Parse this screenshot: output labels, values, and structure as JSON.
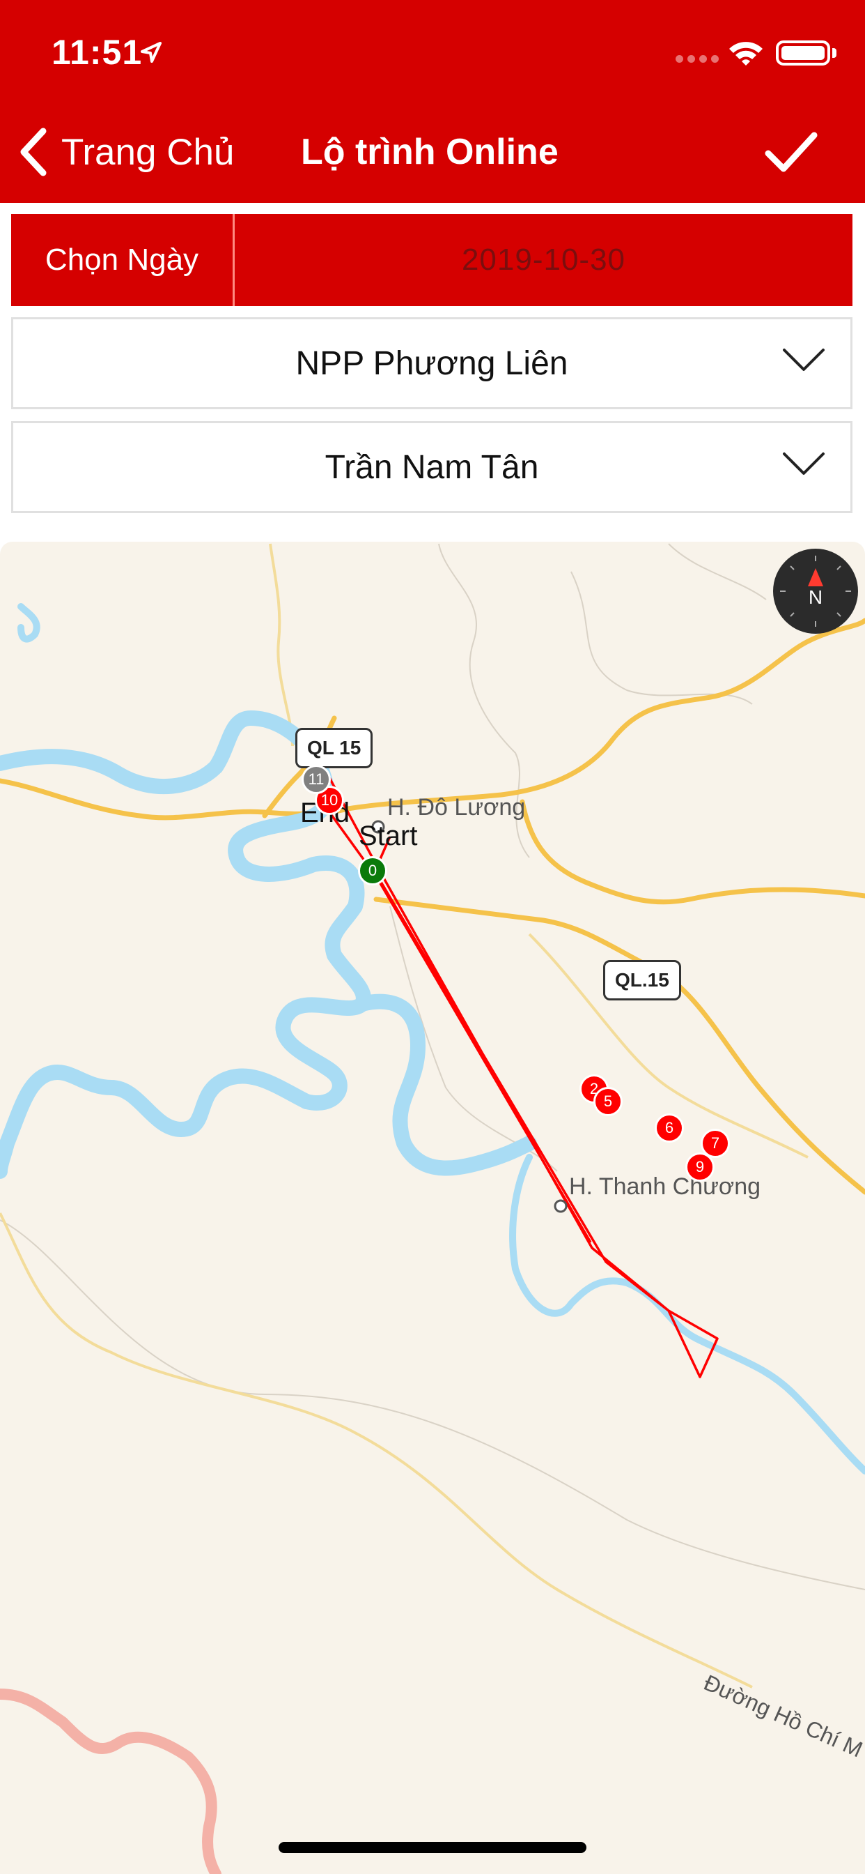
{
  "status_bar": {
    "time": "11:51"
  },
  "nav": {
    "back_label": "Trang Chủ",
    "title": "Lộ trình Online"
  },
  "form": {
    "date_label": "Chọn Ngày",
    "date_value": "2019-10-30",
    "distributor": "NPP Phương Liên",
    "staff": "Trần Nam Tân"
  },
  "map": {
    "road_shields": [
      "QL 15",
      "QL.15"
    ],
    "places": [
      "H. Đô Lương",
      "H. Thanh Chương"
    ],
    "route_labels": {
      "start": "Start",
      "end": "End"
    },
    "street": "Đường Hồ Chí M",
    "compass": "N",
    "markers": [
      {
        "label": "0",
        "color": "#0a7a0a"
      },
      {
        "label": "2",
        "color": "#ff0000"
      },
      {
        "label": "5",
        "color": "#ff0000"
      },
      {
        "label": "6",
        "color": "#ff0000"
      },
      {
        "label": "7",
        "color": "#ff0000"
      },
      {
        "label": "9",
        "color": "#ff0000"
      },
      {
        "label": "10",
        "color": "#ff0000"
      },
      {
        "label": "11",
        "color": "#808080"
      }
    ]
  },
  "colors": {
    "header": "#d50000",
    "route": "#ff0000",
    "river": "#a9dcf4",
    "road": "#f6c244"
  }
}
